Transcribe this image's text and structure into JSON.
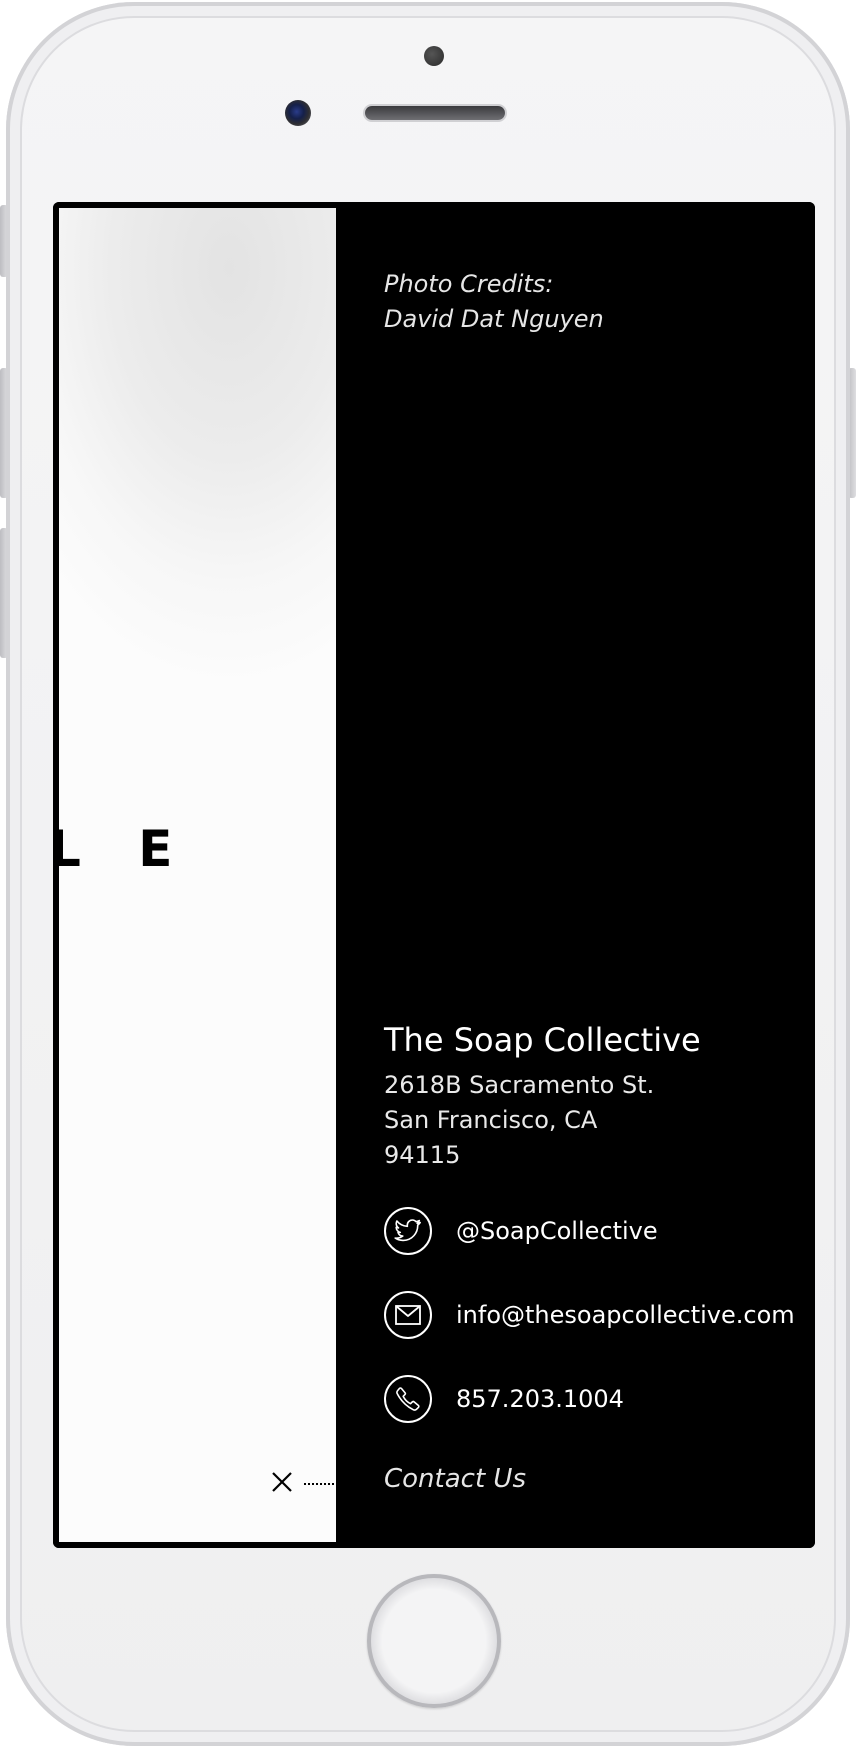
{
  "menu": {
    "photo_credits_line1": "Photo Credits:",
    "photo_credits_line2": "David Dat Nguyen",
    "company_name": "The Soap Collective",
    "address": {
      "line1": "2618B Sacramento St.",
      "line2": "San Francisco, CA",
      "line3": "94115"
    },
    "contacts": [
      {
        "icon": "twitter-icon",
        "text": "@SoapCollective"
      },
      {
        "icon": "mail-icon",
        "text": "info@thesoapcollective.com"
      },
      {
        "icon": "phone-icon",
        "text": "857.203.1004"
      }
    ],
    "contact_us_label": "Contact Us"
  },
  "page": {
    "partial_heading": "L E"
  },
  "colors": {
    "panel_background": "#000000",
    "panel_text": "#ffffff",
    "page_background": "#f7f7f7"
  }
}
